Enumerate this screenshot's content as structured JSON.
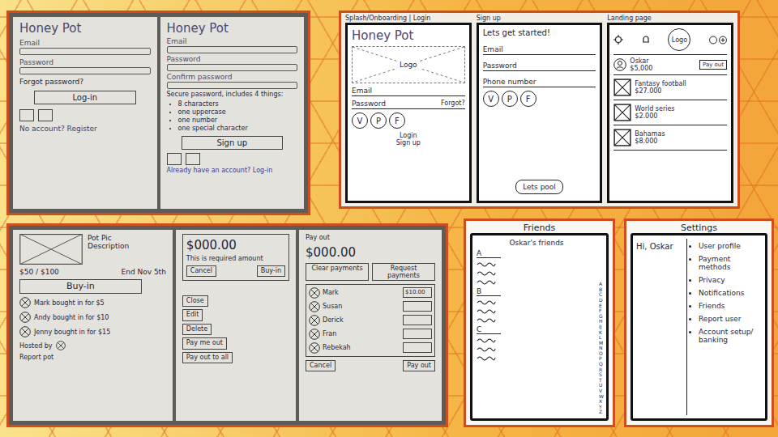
{
  "login_sketch": {
    "login": {
      "title": "Honey Pot",
      "fields": [
        "Email",
        "Password"
      ],
      "forgot": "Forgot password?",
      "button": "Log-in",
      "footer": "No account? Register"
    },
    "signup": {
      "title": "Honey Pot",
      "fields": [
        "Email",
        "Password",
        "Confirm password"
      ],
      "rules_title": "Secure password, includes 4 things:",
      "rules": [
        "8 characters",
        "one uppercase",
        "one number",
        "one special character"
      ],
      "button": "Sign up",
      "footer": "Already have an account? Log-in"
    }
  },
  "screens": {
    "splash": {
      "caption": "Splash/Onboarding | Login",
      "title": "Honey Pot",
      "logo": "Logo",
      "fields": [
        "Email",
        "Password"
      ],
      "forgot": "Forgot?",
      "socials": [
        "V",
        "P",
        "F"
      ],
      "links": [
        "Login",
        "Sign up"
      ]
    },
    "signup": {
      "caption": "Sign up",
      "title": "Lets get started!",
      "fields": [
        "Email",
        "Password",
        "Phone number"
      ],
      "socials": [
        "V",
        "P",
        "F"
      ],
      "button": "Lets pool"
    },
    "landing": {
      "caption": "Landing page",
      "logo": "Logo",
      "user": {
        "name": "Oskar",
        "balance": "$5,000",
        "button": "Pay out"
      },
      "pots": [
        {
          "name": "Fantasy football",
          "amount": "$27.000"
        },
        {
          "name": "World series",
          "amount": "$2.000"
        },
        {
          "name": "Bahamas",
          "amount": "$8.000"
        }
      ]
    }
  },
  "pot_sketch": {
    "detail": {
      "title": "Pot Pic",
      "description": "Description",
      "goal": "$50 / $100",
      "end": "End Nov 5th",
      "button": "Buy-in",
      "buyers": [
        "Mark bought in for $5",
        "Andy bought in for $10",
        "Jenny bought in for $15"
      ],
      "host": "Hosted by",
      "report": "Report pot"
    },
    "buy_in": {
      "amount": "$000.00",
      "note": "This is required amount",
      "buttons": [
        "Cancel",
        "Buy-in"
      ],
      "actions": [
        "Close",
        "Edit",
        "Delete",
        "Pay me out",
        "Pay out to all"
      ]
    },
    "pay_out": {
      "label": "Pay out",
      "amount": "$000.00",
      "buttons": [
        "Clear payments",
        "Request payments"
      ],
      "members": [
        {
          "name": "Mark",
          "amount": "$10.00"
        },
        {
          "name": "Susan"
        },
        {
          "name": "Derick"
        },
        {
          "name": "Fran"
        },
        {
          "name": "Rebekah"
        }
      ],
      "footer": [
        "Cancel",
        "Pay out"
      ]
    }
  },
  "friends": {
    "caption": "Friends",
    "title": "Oskar's friends",
    "sections": [
      "A",
      "B",
      "C"
    ],
    "index": "ABCDEFGHIJKLMNOPQRSTUVWXYZ"
  },
  "settings": {
    "caption": "Settings",
    "greeting": "Hi, Oskar",
    "items": [
      "User profile",
      "Payment methods",
      "Privacy",
      "Notifications",
      "Friends",
      "Report user",
      "Account setup/ banking"
    ]
  }
}
